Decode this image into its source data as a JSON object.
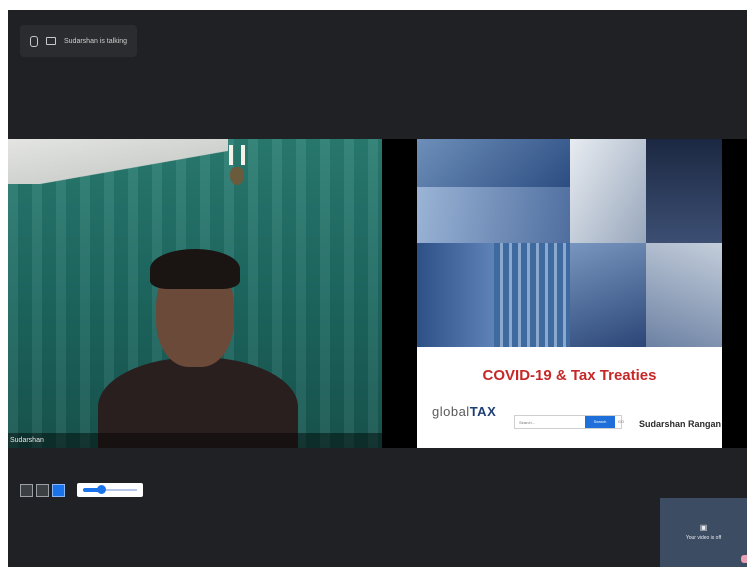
{
  "meeting": {
    "talking_indicator": "Sudarshan is talking"
  },
  "participants": {
    "main_name": "Sudarshan"
  },
  "slide": {
    "title": "COVID-19 & Tax Treaties",
    "logo_prefix": "global",
    "logo_main": "TAX",
    "search_placeholder": "Search...",
    "search_button": "Search",
    "search_go": "GO",
    "author": "Sudarshan Rangan"
  },
  "self_view": {
    "status": "Your video is off"
  },
  "controls": {
    "zoom_level": 0.25
  }
}
